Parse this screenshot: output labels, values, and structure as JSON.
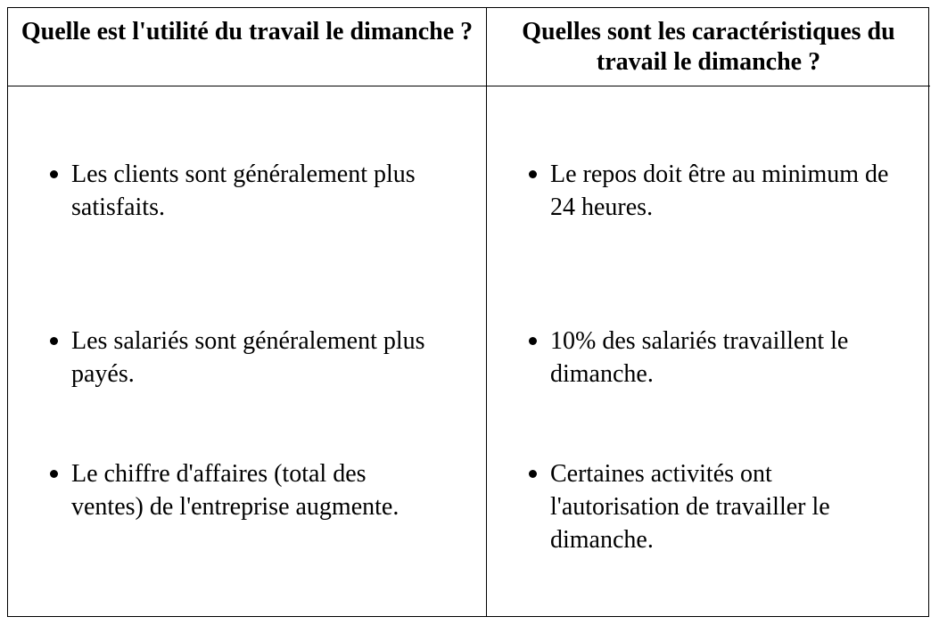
{
  "table": {
    "headers": [
      "Quelle est l'utilité du travail le dimanche ?",
      "Quelles sont les caractéristiques du travail le dimanche ?"
    ],
    "left_items": [
      "Les clients sont généralement plus satisfaits.",
      "Les salariés sont généralement plus payés.",
      "Le chiffre d'affaires (total des ventes) de l'entreprise augmente."
    ],
    "right_items": [
      "Le repos doit être au minimum de 24 heures.",
      "10% des salariés travaillent le dimanche.",
      "Certaines activités ont l'autorisation de travailler le dimanche."
    ]
  }
}
